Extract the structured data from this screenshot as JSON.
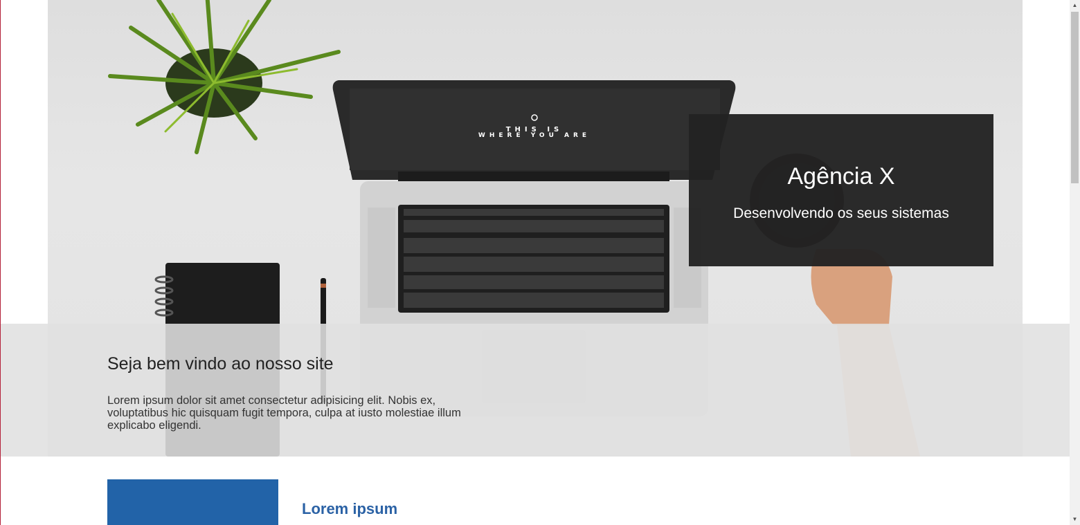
{
  "hero": {
    "image_icon": "laptop-desk-photo",
    "screen_text_line1": "THIS IS",
    "screen_text_line2": "WHERE YOU ARE"
  },
  "brand": {
    "title": "Agência X",
    "subtitle": "Desenvolvendo os seus sistemas"
  },
  "welcome": {
    "heading": "Seja bem vindo ao nosso site",
    "paragraph": "Lorem ipsum dolor sit amet consectetur adipisicing elit. Nobis ex, voluptatibus hic quisquam fugit tempora, culpa at iusto molestiae illum explicabo eligendi."
  },
  "section": {
    "title": "Lorem ipsum"
  },
  "colors": {
    "accent_blue": "#2263a8",
    "title_blue": "#2b62a5",
    "dark_box": "#222222",
    "band_gray": "#e0e0e0"
  },
  "scrollbar": {
    "up_icon": "scroll-up-arrow-icon",
    "down_icon": "scroll-down-arrow-icon"
  }
}
